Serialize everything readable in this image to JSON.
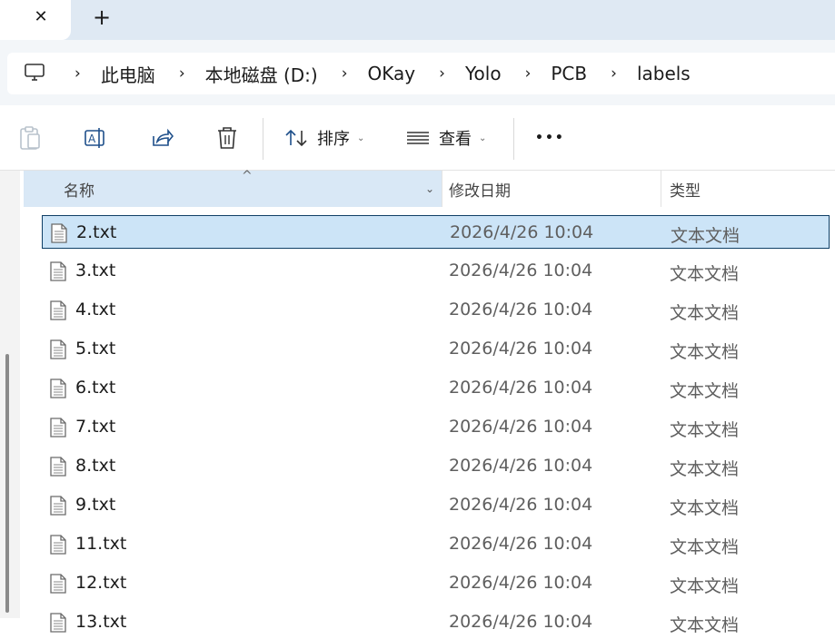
{
  "tabs": {
    "close_glyph": "✕",
    "new_glyph": "+"
  },
  "address": {
    "separator": "›",
    "crumbs": [
      "此电脑",
      "本地磁盘 (D:)",
      "OKay",
      "Yolo",
      "PCB",
      "labels"
    ]
  },
  "toolbar": {
    "sort_label": "排序",
    "view_label": "查看",
    "more_label": "•••",
    "chevron": "⌄"
  },
  "columns": {
    "name": "名称",
    "date": "修改日期",
    "type": "类型",
    "sort_glyph": "^",
    "dropdown_glyph": "⌄"
  },
  "files": [
    {
      "name": "2.txt",
      "date": "2026/4/26 10:04",
      "type": "文本文档",
      "selected": true
    },
    {
      "name": "3.txt",
      "date": "2026/4/26 10:04",
      "type": "文本文档"
    },
    {
      "name": "4.txt",
      "date": "2026/4/26 10:04",
      "type": "文本文档"
    },
    {
      "name": "5.txt",
      "date": "2026/4/26 10:04",
      "type": "文本文档"
    },
    {
      "name": "6.txt",
      "date": "2026/4/26 10:04",
      "type": "文本文档"
    },
    {
      "name": "7.txt",
      "date": "2026/4/26 10:04",
      "type": "文本文档"
    },
    {
      "name": "8.txt",
      "date": "2026/4/26 10:04",
      "type": "文本文档"
    },
    {
      "name": "9.txt",
      "date": "2026/4/26 10:04",
      "type": "文本文档"
    },
    {
      "name": "11.txt",
      "date": "2026/4/26 10:04",
      "type": "文本文档"
    },
    {
      "name": "12.txt",
      "date": "2026/4/26 10:04",
      "type": "文本文档"
    },
    {
      "name": "13.txt",
      "date": "2026/4/26 10:04",
      "type": "文本文档"
    }
  ],
  "colors": {
    "selection": "#cce4f7",
    "tabbar": "#dfe9f3",
    "header_highlight": "#d9e8f6"
  }
}
